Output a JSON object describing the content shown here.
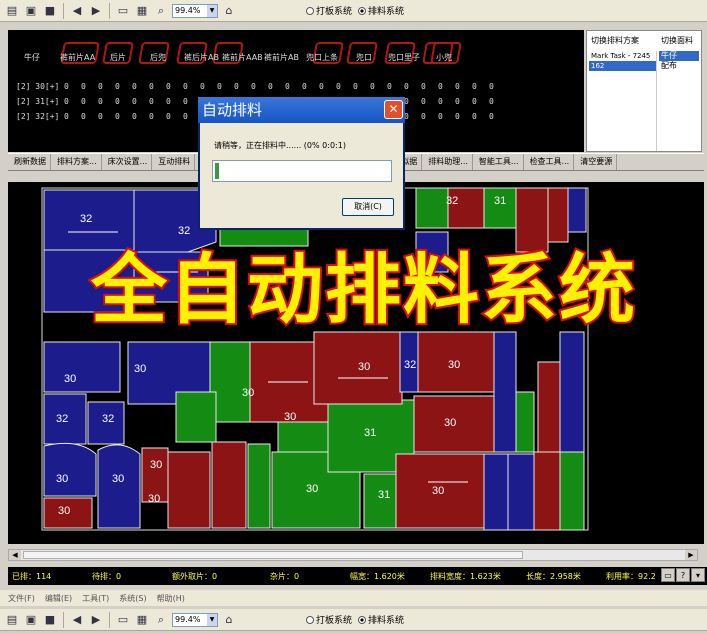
{
  "toolbar": {
    "zoom": "99.4%",
    "radio_options": [
      {
        "label": "打板系统",
        "selected": false
      },
      {
        "label": "排料系统",
        "selected": true
      }
    ]
  },
  "size_table": {
    "headers": [
      "牛仔",
      "裤前片AA",
      "后片",
      "后兜",
      "裤后片AB",
      "裤前片AAB",
      "裤前片AB",
      "兜口上条",
      "兜口",
      "兜口里子",
      "小兜"
    ],
    "rows": [
      {
        "label": "[2] 30[+]",
        "values": [
          "0",
          "0",
          "0",
          "0",
          "0",
          "0",
          "0",
          "0",
          "0",
          "0",
          "0",
          "0",
          "0",
          "0",
          "0",
          "0",
          "0",
          "0",
          "0",
          "0",
          "0",
          "0",
          "0",
          "0",
          "0",
          "0"
        ]
      },
      {
        "label": "[2] 31[+]",
        "values": [
          "0",
          "0",
          "0",
          "0",
          "0",
          "0",
          "0",
          "0",
          "0",
          "0",
          "0",
          "0",
          "0",
          "0",
          "0",
          "0",
          "0",
          "0",
          "0",
          "0",
          "0",
          "0",
          "0",
          "0",
          "0",
          "0"
        ]
      },
      {
        "label": "[2] 32[+]",
        "values": [
          "0",
          "0",
          "0",
          "0",
          "0",
          "0",
          "0",
          "0",
          "0",
          "0",
          "0",
          "0",
          "0",
          "0",
          "0",
          "0",
          "0",
          "0",
          "0",
          "0",
          "0",
          "0",
          "0",
          "0",
          "0",
          "0"
        ]
      }
    ]
  },
  "plan_panel": {
    "switch_plan_label": "切换排料方案",
    "switch_fabric_label": "切换面料",
    "plans": [
      "Mark Task - 7245",
      "162"
    ],
    "fabrics": [
      "牛仔",
      "配布"
    ]
  },
  "func_buttons": [
    "刷新数据",
    "排料方案...",
    "床次设置...",
    "互动排料",
    "拟据",
    "排料助理...",
    "智能工具...",
    "检查工具...",
    "清空要源"
  ],
  "dialog": {
    "title": "自动排料",
    "message": "请稍等，正在排料中...... (0%  0:0:1)",
    "progress_percent": 2,
    "cancel_label": "取消(C)"
  },
  "overlay_text": "全自动排料系统",
  "status_bar": {
    "placed": "已排：114",
    "pending": "待排：0",
    "extra": "额外取片：0",
    "misc": "杂片：0",
    "width": "幅宽：1.620米",
    "mark_width": "排料宽度：1.623米",
    "length": "长度：2.958米",
    "utilization": "利用率：92.2"
  },
  "menu": [
    "文件(F)",
    "编辑(E)",
    "工具(T)",
    "系统(S)",
    "帮助(H)"
  ],
  "colors": {
    "blue": "#1c1c8c",
    "red": "#8c1414",
    "green": "#148c14",
    "overlay_yellow": "#fff200",
    "overlay_stroke": "#d01010"
  }
}
